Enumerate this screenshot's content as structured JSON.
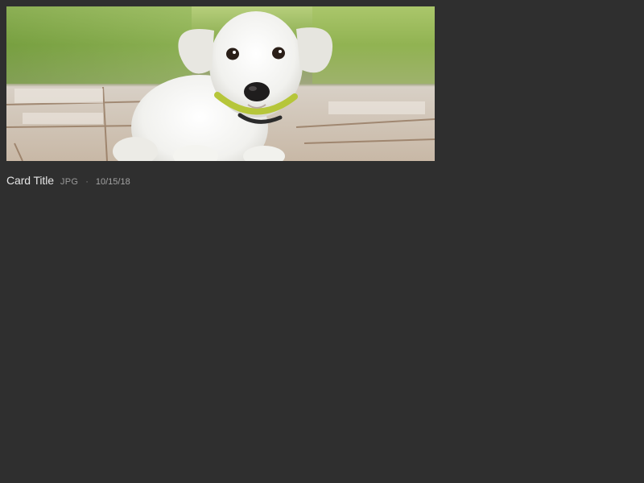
{
  "card": {
    "image_alt": "white puppy on wooden deck",
    "title": "Card Title",
    "type": "JPG",
    "separator": "·",
    "date": "10/15/18"
  },
  "colors": {
    "background": "#2f2f2f",
    "title_text": "#e6e6e6",
    "meta_text": "#9a9a9a"
  }
}
